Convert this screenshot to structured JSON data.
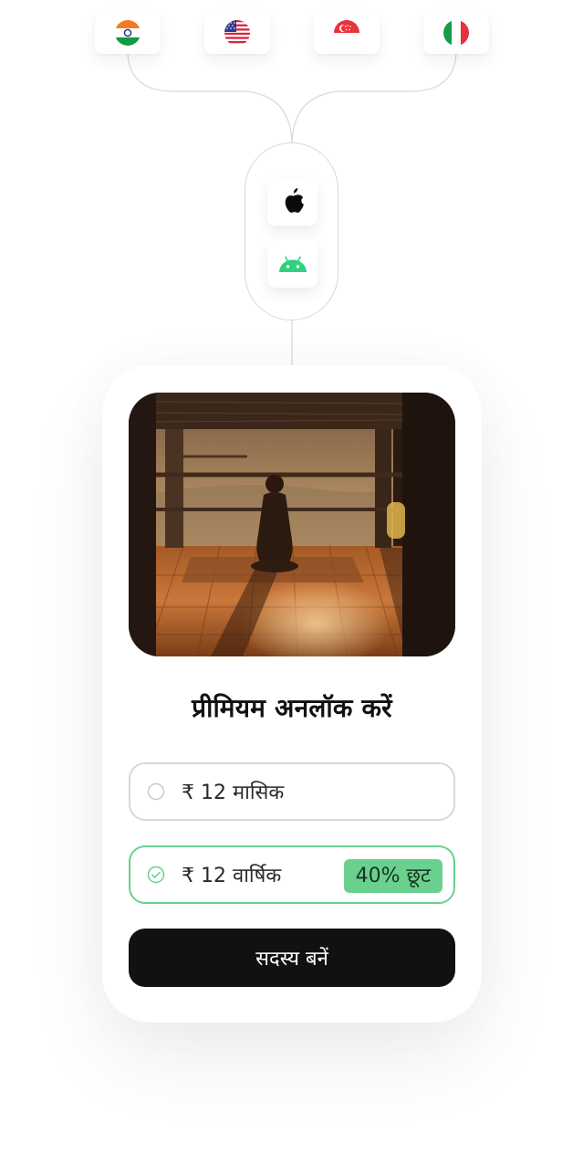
{
  "regions": {
    "flags": [
      {
        "name": "india-flag-icon"
      },
      {
        "name": "usa-flag-icon"
      },
      {
        "name": "singapore-flag-icon"
      },
      {
        "name": "italy-flag-icon"
      }
    ]
  },
  "platforms": [
    {
      "name": "apple-icon"
    },
    {
      "name": "android-icon"
    }
  ],
  "paywall": {
    "title": "प्रीमियम अनलॉक करें",
    "options": [
      {
        "label": "₹ 12 मासिक",
        "selected": false
      },
      {
        "label": "₹ 12 वार्षिक",
        "selected": true,
        "badge": "40% छूट"
      }
    ],
    "cta_label": "सदस्य बनें"
  },
  "colors": {
    "accent_green": "#6ad08e",
    "cta_background": "#111111",
    "option_border": "#d3d8df",
    "connector_line": "#d6d8dc"
  }
}
